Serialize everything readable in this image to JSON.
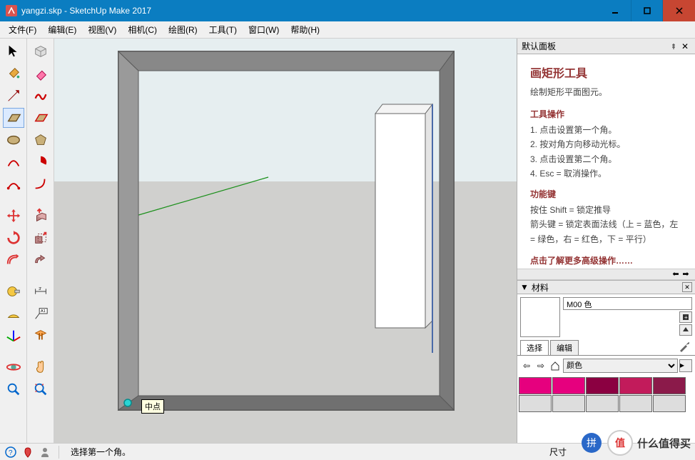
{
  "title": "yangzi.skp - SketchUp Make 2017",
  "menu": [
    "文件(F)",
    "编辑(E)",
    "视图(V)",
    "相机(C)",
    "绘图(R)",
    "工具(T)",
    "窗口(W)",
    "帮助(H)"
  ],
  "panel": {
    "title": "默认面板"
  },
  "instructor": {
    "title": "画矩形工具",
    "subtitle": "绘制矩形平面图元。",
    "ops_h": "工具操作",
    "ops": [
      "1. 点击设置第一个角。",
      "2. 按对角方向移动光标。",
      "3. 点击设置第二个角。",
      "4. Esc = 取消操作。"
    ],
    "keys_h": "功能键",
    "keys": "按住 Shift = 锁定推导\n箭头键 = 锁定表面法线（上 = 蓝色，左 = 绿色，右 = 红色，下 = 平行）",
    "link": "点击了解更多高级操作……"
  },
  "materials": {
    "header": "材料",
    "name": "M00 色",
    "tab_sel": "选择",
    "tab_edit": "编辑",
    "dropdown": "颜色",
    "swatches": [
      "#e6007e",
      "#e6007e",
      "#8b0041",
      "#c21b5b",
      "#8b1a4a",
      "#ddd",
      "#ddd",
      "#ddd",
      "#ddd",
      "#ddd"
    ]
  },
  "status": {
    "hint": "选择第一个角。",
    "dim_label": "尺寸"
  },
  "tooltip": "中点",
  "badge": {
    "zdm": "什么值得买",
    "z": "值"
  }
}
